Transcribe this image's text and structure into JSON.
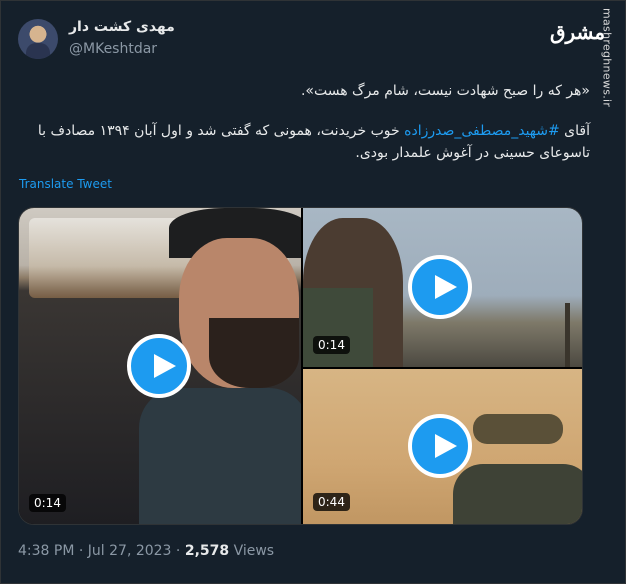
{
  "author": {
    "display_name": "مهدی کشت دار",
    "handle": "@MKeshtdar"
  },
  "branding": {
    "logo_text": "مشرق",
    "watermark": "mashreghnews.ir"
  },
  "tweet": {
    "quote": "«هر که را صبح شهادت نیست، شام مرگ هست».",
    "body_prefix": "آقای ",
    "hashtag": "#شهید_مصطفی_صدرزاده",
    "body_suffix": " خوب خریدنت، همونی که گفتی شد و اول آبان ۱۳۹۴ مصادف با تاسوعای حسینی در آغوش علمدار بودی."
  },
  "translate_label": "Translate Tweet",
  "media": [
    {
      "duration": "0:14",
      "icon": "play-icon"
    },
    {
      "duration": "0:14",
      "icon": "play-icon"
    },
    {
      "duration": "0:44",
      "icon": "play-icon"
    }
  ],
  "meta": {
    "time": "4:38 PM",
    "separator": " · ",
    "date": "Jul 27, 2023",
    "views_count": "2,578",
    "views_label": " Views"
  },
  "colors": {
    "background": "#15202b",
    "accent": "#1d9bf0",
    "muted": "#8b98a5"
  }
}
